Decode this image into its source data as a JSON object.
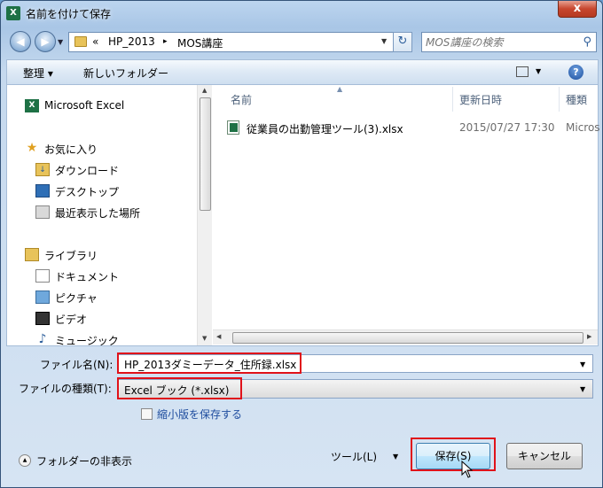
{
  "window": {
    "title": "名前を付けて保存",
    "close_label": "x",
    "app_icon_letter": "X"
  },
  "nav": {
    "back_icon": "arrow-left-icon",
    "forward_icon": "arrow-right-icon",
    "breadcrumb_prefix": "«",
    "breadcrumb": [
      "HP_2013",
      "MOS講座"
    ],
    "crumb_sep": "▸",
    "search_placeholder": "MOS講座の検索"
  },
  "toolbar": {
    "organize_label": "整理 ▾",
    "new_folder_label": "新しいフォルダー"
  },
  "sidebar": {
    "items": [
      {
        "label": "Microsoft Excel",
        "icon": "excel-icon",
        "level": 0
      },
      {
        "label": "お気に入り",
        "icon": "star-icon",
        "level": 0
      },
      {
        "label": "ダウンロード",
        "icon": "download-folder-icon",
        "level": 1
      },
      {
        "label": "デスクトップ",
        "icon": "desktop-icon",
        "level": 1
      },
      {
        "label": "最近表示した場所",
        "icon": "recent-places-icon",
        "level": 1
      },
      {
        "label": "ライブラリ",
        "icon": "library-icon",
        "level": 0
      },
      {
        "label": "ドキュメント",
        "icon": "documents-icon",
        "level": 1
      },
      {
        "label": "ピクチャ",
        "icon": "pictures-icon",
        "level": 1
      },
      {
        "label": "ビデオ",
        "icon": "video-icon",
        "level": 1
      },
      {
        "label": "ミュージック",
        "icon": "music-icon",
        "level": 1
      }
    ]
  },
  "files": {
    "columns": [
      "名前",
      "更新日時",
      "種類"
    ],
    "rows": [
      {
        "name": "従業員の出勤管理ツール(3).xlsx",
        "modified": "2015/07/27 17:30",
        "type": "Micros"
      }
    ]
  },
  "form": {
    "filename_label": "ファイル名(N):",
    "filename_value": "HP_2013ダミーデータ_住所録.xlsx",
    "filetype_label": "ファイルの種類(T):",
    "filetype_value": "Excel ブック (*.xlsx)",
    "thumbnail_label": "縮小版を保存する"
  },
  "footer": {
    "hide_folders_label": "フォルダーの非表示",
    "tools_label": "ツール(L)",
    "save_label": "保存(S)",
    "cancel_label": "キャンセル"
  },
  "colors": {
    "highlight": "#e0121a",
    "title_bar": "#a9c6e6",
    "link": "#1e4c9e"
  }
}
